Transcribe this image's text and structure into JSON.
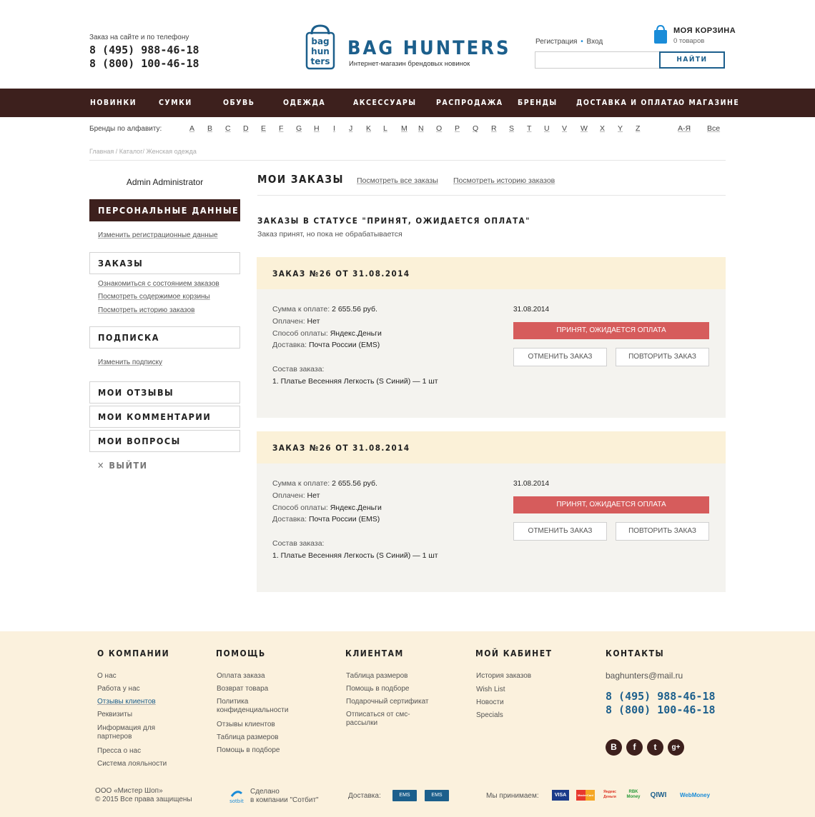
{
  "header": {
    "contact_label": "Заказ на сайте и по телефону",
    "phones": [
      "8 (495) 988-46-18",
      "8 (800) 100-46-18"
    ],
    "logo_name": "BAG HUNTERS",
    "logo_mark_text": "bag hun ters",
    "tagline": "Интернет-магазин брендовых новинок",
    "register": "Регистрация",
    "login": "Вход",
    "cart_title": "МОЯ КОРЗИНА",
    "cart_count": "0 товаров",
    "search_placeholder": "",
    "search_button": "НАЙТИ"
  },
  "nav": [
    "НОВИНКИ",
    "СУМКИ",
    "ОБУВЬ",
    "ОДЕЖДА",
    "АКСЕССУАРЫ",
    "РАСПРОДАЖА",
    "БРЕНДЫ",
    "ДОСТАВКА И ОПЛАТА",
    "О МАГАЗИНЕ"
  ],
  "alphabet": {
    "label": "Бренды по алфавиту:",
    "letters": [
      "A",
      "B",
      "C",
      "D",
      "E",
      "F",
      "G",
      "H",
      "I",
      "J",
      "K",
      "L",
      "M",
      "N",
      "O",
      "P",
      "Q",
      "R",
      "S",
      "T",
      "U",
      "V",
      "W",
      "X",
      "Y",
      "Z"
    ],
    "cyrillic": "А-Я",
    "all": "Все"
  },
  "breadcrumbs": "Главная / Каталог/ Женская одежда",
  "sidebar": {
    "user": "Admin Administrator",
    "personal": "ПЕРСОНАЛЬНЫЕ ДАННЫЕ",
    "personal_link": "Изменить регистрационные данные",
    "orders": "ЗАКАЗЫ",
    "orders_links": [
      "Ознакомиться с состоянием заказов",
      "Посмотреть содержимое корзины",
      "Посмотреть историю заказов"
    ],
    "subscription": "ПОДПИСКА",
    "subscription_link": "Изменить подписку",
    "reviews": "МОИ ОТЗЫВЫ",
    "comments": "МОИ КОММЕНТАРИИ",
    "questions": "МОИ ВОПРОСЫ",
    "logout": "ВЫЙТИ"
  },
  "main": {
    "title": "МОИ ЗАКАЗЫ",
    "link_all": "Посмотреть все заказы",
    "link_history": "Посмотреть историю заказов",
    "status_heading": "ЗАКАЗЫ В СТАТУСЕ \"ПРИНЯТ, ОЖИДАЕТСЯ ОПЛАТА\"",
    "status_sub": "Заказ принят, но пока не обрабатывается",
    "orders": [
      {
        "title": "ЗАКАЗ №26 ОТ 31.08.2014",
        "sum_label": "Сумма к оплате:",
        "sum": "2 655.56 руб.",
        "paid_label": "Оплачен:",
        "paid": "Нет",
        "method_label": "Способ оплаты:",
        "method": "Яндекс.Деньги",
        "delivery_label": "Доставка:",
        "delivery": "Почта России (EMS)",
        "content_label": "Состав заказа:",
        "item": "1. Платье Весенняя Легкость (S Синий)  — 1 шт",
        "date": "31.08.2014",
        "status": "ПРИНЯТ, ОЖИДАЕТСЯ ОПЛАТА",
        "cancel": "ОТМЕНИТЬ ЗАКАЗ",
        "repeat": "ПОВТОРИТЬ ЗАКАЗ"
      },
      {
        "title": "ЗАКАЗ №26 ОТ 31.08.2014",
        "sum_label": "Сумма к оплате:",
        "sum": "2 655.56 руб.",
        "paid_label": "Оплачен:",
        "paid": "Нет",
        "method_label": "Способ оплаты:",
        "method": "Яндекс.Деньги",
        "delivery_label": "Доставка:",
        "delivery": "Почта России (EMS)",
        "content_label": "Состав заказа:",
        "item": "1. Платье Весенняя Легкость (S Синий)  — 1 шт",
        "date": "31.08.2014",
        "status": "ПРИНЯТ, ОЖИДАЕТСЯ ОПЛАТА",
        "cancel": "ОТМЕНИТЬ ЗАКАЗ",
        "repeat": "ПОВТОРИТЬ ЗАКАЗ"
      }
    ]
  },
  "footer": {
    "company_h": "О КОМПАНИИ",
    "company": [
      "О нас",
      "Работа у нас",
      "Отзывы клиентов",
      "Реквизиты",
      "Информация для партнеров",
      "Пресса о нас",
      "Система лояльности"
    ],
    "help_h": "ПОМОЩЬ",
    "help": [
      "Оплата заказа",
      "Возврат товара",
      "Политика конфиденциальности",
      "Отзывы клиентов",
      "Таблица размеров",
      "Помощь в подборе"
    ],
    "clients_h": "КЛИЕНТАМ",
    "clients": [
      "Таблица размеров",
      "Помощь в подборе",
      "Подарочный сертификат",
      "Отписаться от смс-рассылки"
    ],
    "cabinet_h": "МОЙ КАБИНЕТ",
    "cabinet": [
      "История заказов",
      "Wish List",
      "Новости",
      "Specials"
    ],
    "contacts_h": "КОНТАКТЫ",
    "email": "baghunters@mail.ru",
    "phones": [
      "8 (495) 988-46-18",
      "8 (800) 100-46-18"
    ],
    "social": [
      "В",
      "f",
      "t",
      "g+"
    ],
    "copyright": [
      "ООО «Мистер Шоп»",
      "© 2015   Все права защищены"
    ],
    "sotbit_label": "sotbit",
    "made_by": [
      "Сделано",
      "в компании \"Сотбит\""
    ],
    "delivery_label": "Доставка:",
    "delivery_logos": [
      "ЕМS",
      "ЕМS"
    ],
    "pay_label": "Мы принимаем:",
    "pay_logos": [
      "VISA",
      "MasterCard",
      "Яндекс Деньги",
      "RBK Money",
      "QIWI",
      "WebMoney"
    ]
  },
  "colors": {
    "brand": "#3d201d",
    "accent": "#1c5f8c",
    "status": "#d65c5c",
    "order_head": "#fbf1d8",
    "footer_bg": "#fbf1dd"
  }
}
